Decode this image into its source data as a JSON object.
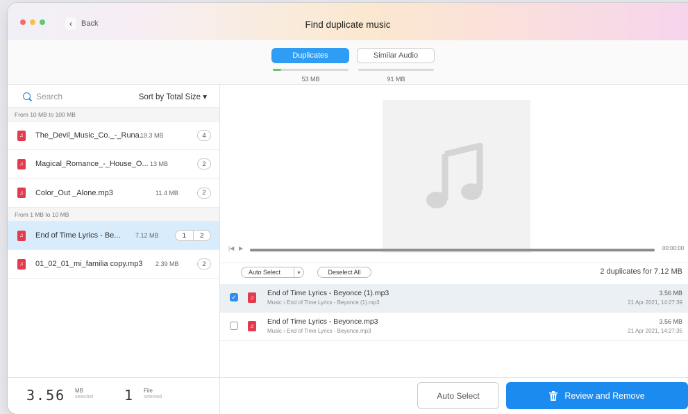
{
  "window": {
    "title": "Find duplicate music",
    "back_label": "Back"
  },
  "tabs": [
    {
      "label": "Duplicates",
      "size": "53 MB",
      "active": true
    },
    {
      "label": "Similar Audio",
      "size": "91 MB",
      "active": false
    }
  ],
  "sidebar": {
    "search_placeholder": "Search",
    "sort_label": "Sort by Total Size ▾",
    "groups": [
      {
        "label": "From 10 MB to 100 MB",
        "items": [
          {
            "name": "The_Devil_Music_Co._-_Runa...",
            "size": "19.3 MB",
            "count": "4"
          },
          {
            "name": "Magical_Romance_-_House_O...",
            "size": "13 MB",
            "count": "2"
          },
          {
            "name": "Color_Out _Alone.mp3",
            "size": "11.4 MB",
            "count": "2"
          }
        ]
      },
      {
        "label": "From 1 MB to 10 MB",
        "items": [
          {
            "name": "End of Time Lyrics - Be...",
            "size": "7.12 MB",
            "count_selected": "1",
            "count": "2",
            "selected": true
          },
          {
            "name": "01_02_01_mi_familia copy.mp3",
            "size": "2.39 MB",
            "count": "2"
          }
        ]
      }
    ]
  },
  "stats": {
    "size_value": "3.56",
    "size_unit": "MB",
    "size_sub": "selected",
    "files_value": "1",
    "files_unit": "File",
    "files_sub": "selected"
  },
  "player": {
    "time": "00:00:00"
  },
  "duplicates_toolbar": {
    "auto_select": "Auto Select",
    "deselect_all": "Deselect All",
    "summary": "2 duplicates for 7.12 MB"
  },
  "files": [
    {
      "name": "End of Time Lyrics - Beyonce (1).mp3",
      "path": "Music › End of Time Lyrics - Beyonce (1).mp3",
      "size": "3.56 MB",
      "date": "21 Apr 2021, 14:27:39",
      "checked": true
    },
    {
      "name": "End of Time Lyrics - Beyonce.mp3",
      "path": "Music › End of Time Lyrics - Beyonce.mp3",
      "size": "3.56 MB",
      "date": "21 Apr 2021, 14:27:35",
      "checked": false
    }
  ],
  "actions": {
    "auto_select": "Auto Select",
    "review_remove": "Review and Remove"
  },
  "colors": {
    "accent": "#1b8bf0",
    "tab_active": "#2f9df4",
    "file_icon": "#e33b4e",
    "progress_fill": "#6bc36b"
  },
  "icons": {
    "file": "music-file-icon",
    "search": "search-icon",
    "trash": "trash-icon",
    "note": "music-note-icon"
  }
}
